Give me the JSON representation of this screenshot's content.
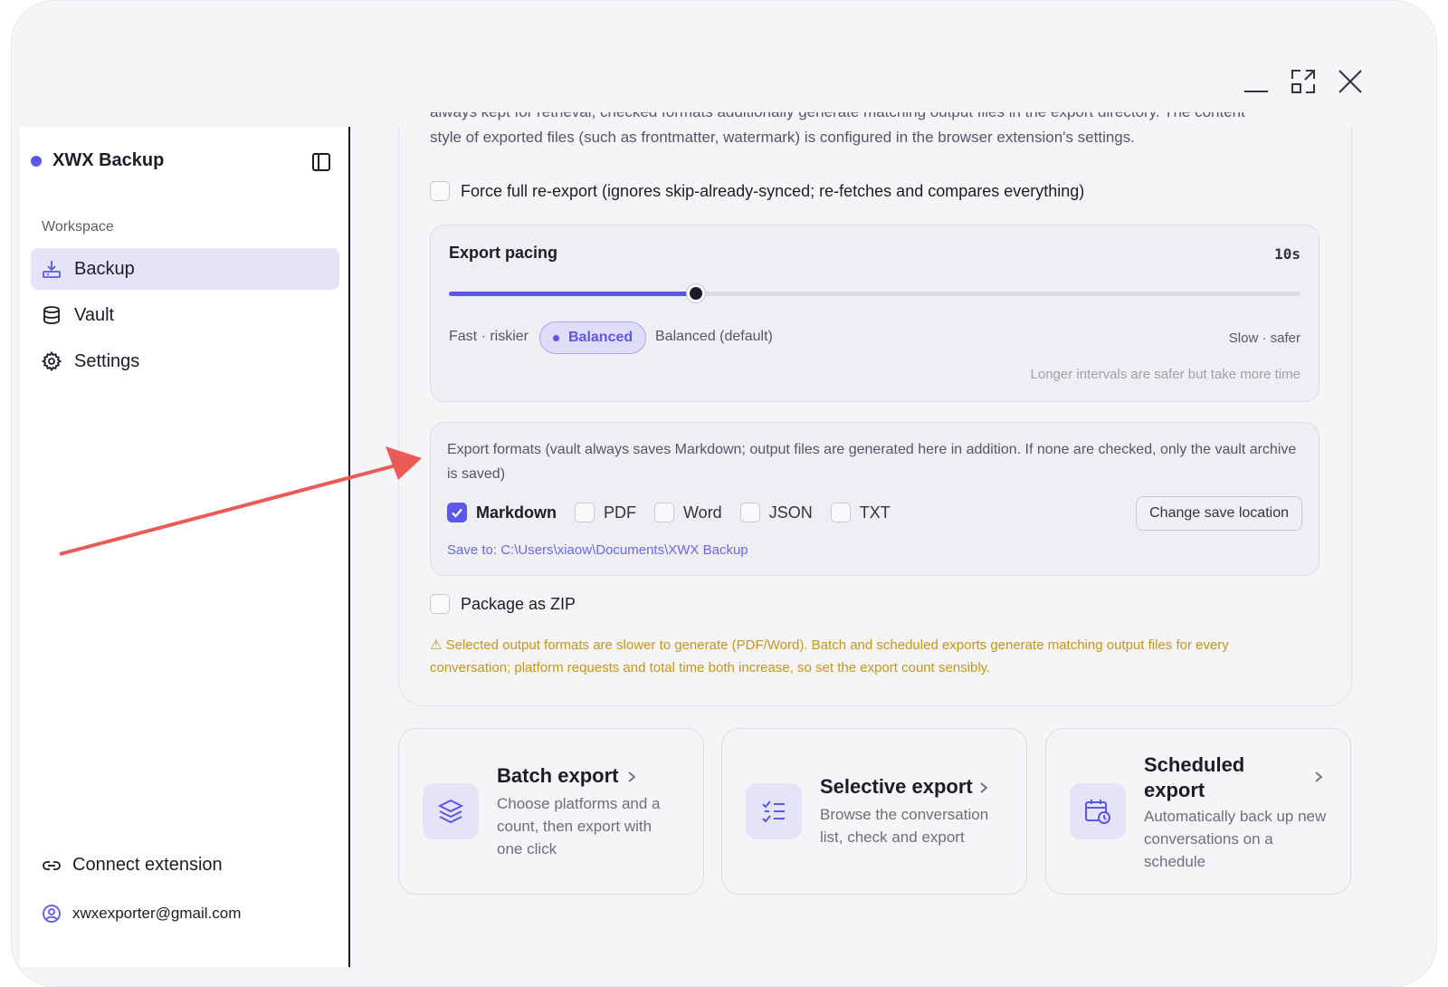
{
  "app": {
    "name": "XWX Backup",
    "brand_color": "#5b57e8"
  },
  "sidebar": {
    "section_label": "Workspace",
    "items": [
      {
        "label": "Backup",
        "icon": "download-tray-icon",
        "active": true
      },
      {
        "label": "Vault",
        "icon": "database-icon",
        "active": false
      },
      {
        "label": "Settings",
        "icon": "gear-icon",
        "active": false
      }
    ],
    "connect_label": "Connect extension",
    "email": "xwxexporter@gmail.com"
  },
  "intro": {
    "line1": "always kept for retrieval; checked formats additionally generate matching output files in the export directory. The content",
    "line2": "style of exported files (such as frontmatter, watermark) is configured in the browser extension's settings."
  },
  "force_reexport": {
    "label": "Force full re-export (ignores skip-already-synced; re-fetches and compares everything)",
    "checked": false
  },
  "pacing": {
    "title": "Export pacing",
    "value": "10s",
    "level": 0.29,
    "fast_label": "Fast · riskier",
    "selected_label": "Balanced",
    "default_label": "Balanced (default)",
    "slow_label": "Slow · safer",
    "hint": "Longer intervals are safer but take more time"
  },
  "formats": {
    "description": "Export formats (vault always saves Markdown; output files are generated here in addition. If none are checked, only the vault archive is saved)",
    "options": [
      {
        "label": "Markdown",
        "checked": true
      },
      {
        "label": "PDF",
        "checked": false
      },
      {
        "label": "Word",
        "checked": false
      },
      {
        "label": "JSON",
        "checked": false
      },
      {
        "label": "TXT",
        "checked": false
      }
    ],
    "change_location_label": "Change save location",
    "save_path": "Save to: C:\\Users\\xiaow\\Documents\\XWX Backup"
  },
  "zip": {
    "label": "Package as ZIP",
    "checked": false
  },
  "warning": "⚠ Selected output formats are slower to generate (PDF/Word). Batch and scheduled exports generate matching output files for every conversation; platform requests and total time both increase, so set the export count sensibly.",
  "actions": [
    {
      "title": "Batch export",
      "desc": "Choose platforms and a count, then export with one click",
      "icon": "layers-icon"
    },
    {
      "title": "Selective export",
      "desc": "Browse the conversation list, check and export",
      "icon": "checklist-icon"
    },
    {
      "title": "Scheduled export",
      "desc": "Automatically back up new conversations on a schedule",
      "icon": "calendar-clock-icon"
    }
  ]
}
